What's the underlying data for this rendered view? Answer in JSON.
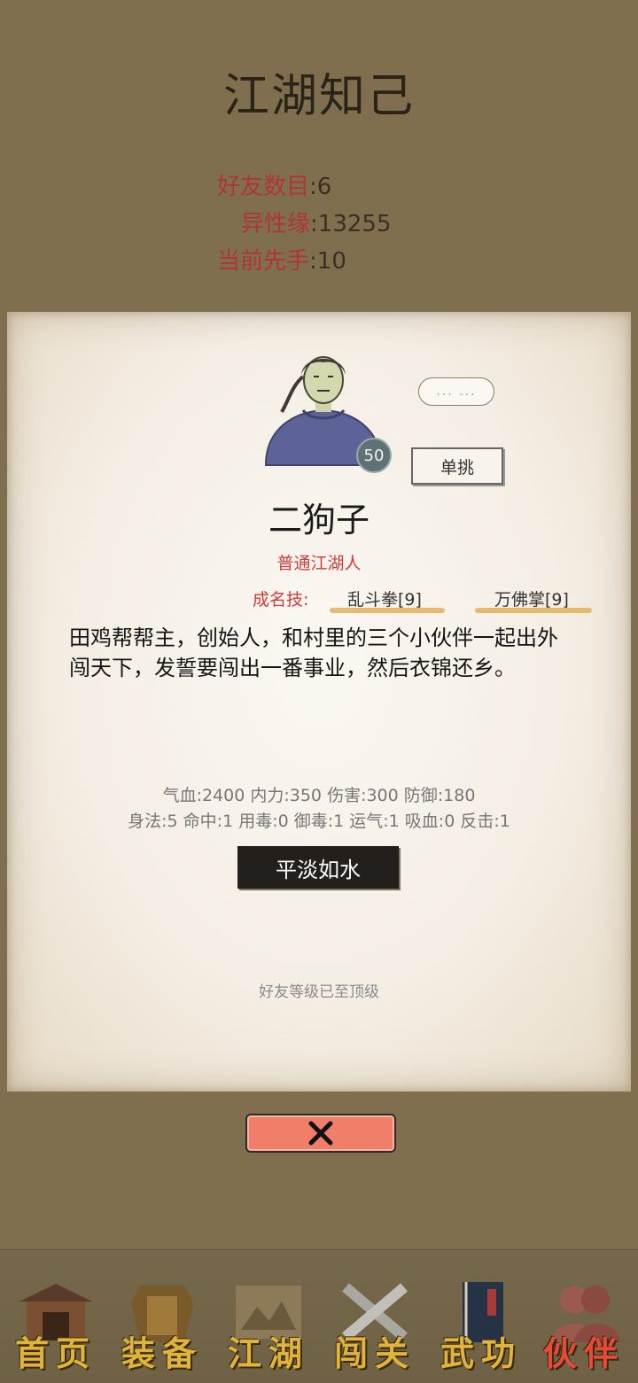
{
  "header": {
    "title": "江湖知己",
    "stats": [
      {
        "label": "好友数目",
        "value": "6"
      },
      {
        "label": "异性缘",
        "value": "13255"
      },
      {
        "label": "当前先手",
        "value": "10"
      }
    ]
  },
  "friend": {
    "level": "50",
    "bubble_text": "... ...",
    "duel_label": "单挑",
    "name": "二狗子",
    "rank": "普通江湖人",
    "skills_label": "成名技:",
    "skills": [
      "乱斗拳[9]",
      "万佛掌[9]"
    ],
    "description": "田鸡帮帮主，创始人，和村里的三个小伙伴一起出外闯天下，发誓要闯出一番事业，然后衣锦还乡。",
    "attrs_line1": "气血:2400  内力:350  伤害:300  防御:180",
    "attrs_line2": "身法:5  命中:1  用毒:0  御毒:1  运气:1  吸血:0  反击:1",
    "mood": "平淡如水",
    "max_note": "好友等级已至顶级"
  },
  "nav": [
    {
      "label": "首页",
      "icon": "house-icon"
    },
    {
      "label": "装备",
      "icon": "armor-icon"
    },
    {
      "label": "江湖",
      "icon": "scroll-map-icon"
    },
    {
      "label": "闯关",
      "icon": "crossed-swords-icon"
    },
    {
      "label": "武功",
      "icon": "book-icon"
    },
    {
      "label": "伙伴",
      "icon": "companions-icon"
    }
  ],
  "colors": {
    "background": "#7f6f4f",
    "accent_red": "#d23b3b",
    "close_button": "#f07e69",
    "nav_label": "#e0b43a"
  }
}
